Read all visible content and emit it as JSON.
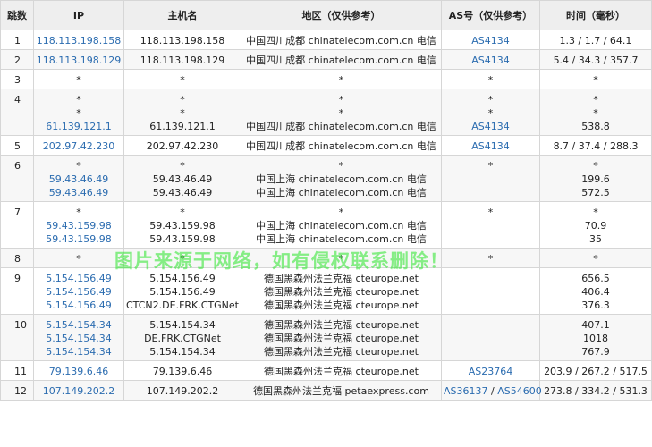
{
  "header": {
    "hop": "跳数",
    "ip": "IP",
    "host": "主机名",
    "region": "地区（仅供参考）",
    "as": "AS号（仅供参考）",
    "time": "时间（毫秒）"
  },
  "rows": [
    {
      "hop": "1",
      "ips": [
        "118.113.198.158"
      ],
      "hosts": [
        "118.113.198.158"
      ],
      "regions": [
        "中国四川成都 chinatelecom.com.cn 电信"
      ],
      "as": [
        [
          "AS4134"
        ]
      ],
      "times": [
        "1.3 / 1.7 / 64.1"
      ]
    },
    {
      "hop": "2",
      "ips": [
        "118.113.198.129"
      ],
      "hosts": [
        "118.113.198.129"
      ],
      "regions": [
        "中国四川成都 chinatelecom.com.cn 电信"
      ],
      "as": [
        [
          "AS4134"
        ]
      ],
      "times": [
        "5.4 / 34.3 / 357.7"
      ]
    },
    {
      "hop": "3",
      "ips": [
        "*"
      ],
      "hosts": [
        "*"
      ],
      "regions": [
        "*"
      ],
      "as": [
        [
          "*"
        ]
      ],
      "times": [
        "*"
      ]
    },
    {
      "hop": "4",
      "ips": [
        "*",
        "*",
        "61.139.121.1"
      ],
      "hosts": [
        "*",
        "*",
        "61.139.121.1"
      ],
      "regions": [
        "*",
        "*",
        "中国四川成都 chinatelecom.com.cn 电信"
      ],
      "as": [
        [
          "*"
        ],
        [
          "*"
        ],
        [
          "AS4134"
        ]
      ],
      "times": [
        "*",
        "*",
        "538.8"
      ]
    },
    {
      "hop": "5",
      "ips": [
        "202.97.42.230"
      ],
      "hosts": [
        "202.97.42.230"
      ],
      "regions": [
        "中国四川成都 chinatelecom.com.cn 电信"
      ],
      "as": [
        [
          "AS4134"
        ]
      ],
      "times": [
        "8.7 / 37.4 / 288.3"
      ]
    },
    {
      "hop": "6",
      "ips": [
        "*",
        "59.43.46.49",
        "59.43.46.49"
      ],
      "hosts": [
        "*",
        "59.43.46.49",
        "59.43.46.49"
      ],
      "regions": [
        "*",
        "中国上海 chinatelecom.com.cn 电信",
        "中国上海 chinatelecom.com.cn 电信"
      ],
      "as": [
        [
          "*"
        ]
      ],
      "times": [
        "*",
        "199.6",
        "572.5"
      ]
    },
    {
      "hop": "7",
      "ips": [
        "*",
        "59.43.159.98",
        "59.43.159.98"
      ],
      "hosts": [
        "*",
        "59.43.159.98",
        "59.43.159.98"
      ],
      "regions": [
        "*",
        "中国上海 chinatelecom.com.cn 电信",
        "中国上海 chinatelecom.com.cn 电信"
      ],
      "as": [
        [
          "*"
        ]
      ],
      "times": [
        "*",
        "70.9",
        "35"
      ]
    },
    {
      "hop": "8",
      "ips": [
        "*"
      ],
      "hosts": [
        "*"
      ],
      "regions": [
        "*"
      ],
      "as": [
        [
          "*"
        ]
      ],
      "times": [
        "*"
      ]
    },
    {
      "hop": "9",
      "ips": [
        "5.154.156.49",
        "5.154.156.49",
        "5.154.156.49"
      ],
      "hosts": [
        "5.154.156.49",
        "5.154.156.49",
        "CTCN2.DE.FRK.CTGNet"
      ],
      "regions": [
        "德国黑森州法兰克福 cteurope.net",
        "德国黑森州法兰克福 cteurope.net",
        "德国黑森州法兰克福 cteurope.net"
      ],
      "as": [],
      "times": [
        "656.5",
        "406.4",
        "376.3"
      ]
    },
    {
      "hop": "10",
      "ips": [
        "5.154.154.34",
        "5.154.154.34",
        "5.154.154.34"
      ],
      "hosts": [
        "5.154.154.34",
        "DE.FRK.CTGNet",
        "5.154.154.34"
      ],
      "regions": [
        "德国黑森州法兰克福 cteurope.net",
        "德国黑森州法兰克福 cteurope.net",
        "德国黑森州法兰克福 cteurope.net"
      ],
      "as": [],
      "times": [
        "407.1",
        "1018",
        "767.9"
      ]
    },
    {
      "hop": "11",
      "ips": [
        "79.139.6.46"
      ],
      "hosts": [
        "79.139.6.46"
      ],
      "regions": [
        "德国黑森州法兰克福 cteurope.net"
      ],
      "as": [
        [
          "AS23764"
        ]
      ],
      "times": [
        "203.9 / 267.2 / 517.5"
      ]
    },
    {
      "hop": "12",
      "ips": [
        "107.149.202.2"
      ],
      "hosts": [
        "107.149.202.2"
      ],
      "regions": [
        "德国黑森州法兰克福 petaexpress.com"
      ],
      "as": [
        [
          "AS36137",
          "AS54600"
        ]
      ],
      "times": [
        "273.8 / 334.2 / 531.3"
      ]
    }
  ],
  "watermark": "图片来源于网络，如有侵权联系删除！",
  "colors": {
    "link": "#2b6cb0",
    "header_bg": "#eeeeee",
    "stripe_bg": "#f7f7f7",
    "border": "#d6d6d6"
  }
}
